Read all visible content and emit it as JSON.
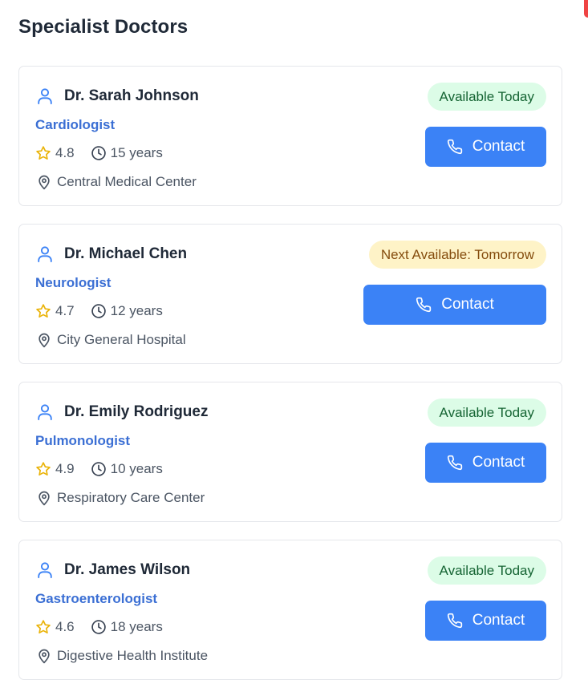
{
  "page": {
    "title": "Specialist Doctors"
  },
  "colors": {
    "accent": "#3b82f6",
    "specialty": "#3b6fd4",
    "available_bg": "#dcfce7",
    "available_text": "#166534",
    "next_bg": "#fef3c7",
    "next_text": "#854d0e",
    "star": "#facc15"
  },
  "icons": {
    "user": "user-icon",
    "star": "star-icon",
    "clock": "clock-icon",
    "location": "map-pin-icon",
    "phone": "phone-icon"
  },
  "doctors": [
    {
      "name": "Dr. Sarah Johnson",
      "specialty": "Cardiologist",
      "rating": "4.8",
      "experience": "15 years",
      "location": "Central Medical Center",
      "availability": "Available Today",
      "availability_status": "available",
      "contact_label": "Contact"
    },
    {
      "name": "Dr. Michael Chen",
      "specialty": "Neurologist",
      "rating": "4.7",
      "experience": "12 years",
      "location": "City General Hospital",
      "availability": "Next Available: Tomorrow",
      "availability_status": "next",
      "contact_label": "Contact"
    },
    {
      "name": "Dr. Emily Rodriguez",
      "specialty": "Pulmonologist",
      "rating": "4.9",
      "experience": "10 years",
      "location": "Respiratory Care Center",
      "availability": "Available Today",
      "availability_status": "available",
      "contact_label": "Contact"
    },
    {
      "name": "Dr. James Wilson",
      "specialty": "Gastroenterologist",
      "rating": "4.6",
      "experience": "18 years",
      "location": "Digestive Health Institute",
      "availability": "Available Today",
      "availability_status": "available",
      "contact_label": "Contact"
    }
  ]
}
